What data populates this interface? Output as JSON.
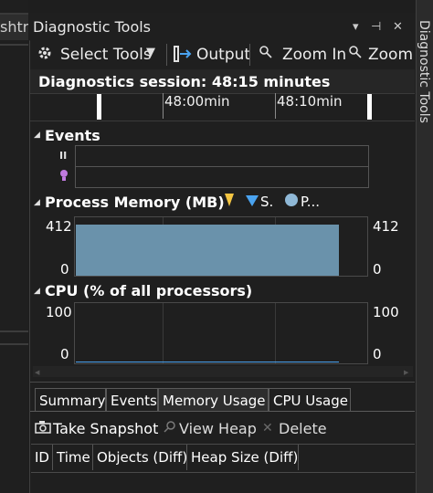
{
  "left_panel": {
    "tab_fragment": "shtr"
  },
  "window": {
    "title": "Diagnostic Tools",
    "vertical_tab_label": "Diagnostic Tools",
    "buttons": {
      "dropdown": "▾",
      "pin": "⊣",
      "close": "✕"
    }
  },
  "toolbar": {
    "select_tools": "Select Tools",
    "output": "Output",
    "zoom_in": "Zoom In",
    "zoom_out_partial": "Zoom"
  },
  "session": {
    "text": "Diagnostics session: 48:15 minutes"
  },
  "ruler": {
    "labels": [
      "48:00min",
      "48:10min"
    ]
  },
  "events": {
    "title": "Events"
  },
  "process_memory": {
    "title": "Process Memory (MB)",
    "legend": [
      {
        "label": "",
        "color": "#f4c542",
        "icon": "gc-marker-icon"
      },
      {
        "label": "S.",
        "color": "#4aa3f0",
        "icon": "snapshot-marker-icon"
      },
      {
        "label": "P...",
        "color": "#8fb8d6",
        "icon": "private-bytes-icon"
      }
    ],
    "y_max": "412",
    "y_min": "0",
    "fill_color": "#6a92ab",
    "fill_fraction": 0.88
  },
  "cpu": {
    "title": "CPU (% of all processors)",
    "y_max": "100",
    "y_min": "0"
  },
  "tabs": [
    {
      "label": "Summary",
      "active": false
    },
    {
      "label": "Events",
      "active": false
    },
    {
      "label": "Memory Usage",
      "active": true
    },
    {
      "label": "CPU Usage",
      "active": false
    }
  ],
  "actions": {
    "take_snapshot": "Take Snapshot",
    "view_heap": "View Heap",
    "delete": "Delete"
  },
  "table": {
    "columns": [
      "ID",
      "Time",
      "Objects (Diff)",
      "Heap Size (Diff)"
    ]
  }
}
